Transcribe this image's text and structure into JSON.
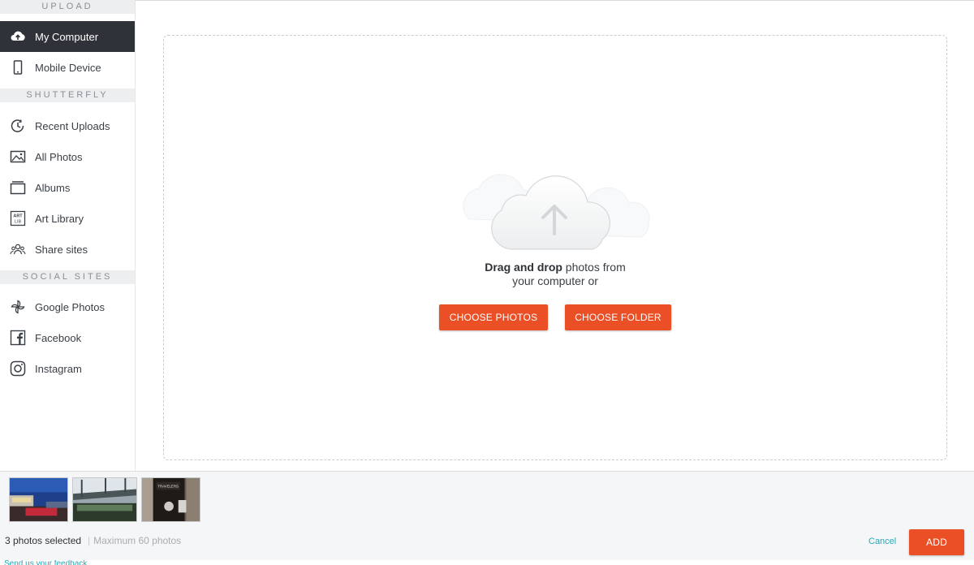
{
  "sidebar": {
    "sections": [
      {
        "header": "UPLOAD"
      },
      {
        "header": "SHUTTERFLY"
      },
      {
        "header": "SOCIAL SITES"
      }
    ],
    "items": [
      {
        "label": "My Computer",
        "icon": "cloud-upload-icon",
        "active": true
      },
      {
        "label": "Mobile Device",
        "icon": "mobile-device-icon"
      },
      {
        "label": "Recent Uploads",
        "icon": "recent-clock-icon"
      },
      {
        "label": "All Photos",
        "icon": "photo-icon"
      },
      {
        "label": "Albums",
        "icon": "album-icon"
      },
      {
        "label": "Art Library",
        "icon": "art-library-icon",
        "icon_text": "ART LIB"
      },
      {
        "label": "Share sites",
        "icon": "share-sites-icon"
      },
      {
        "label": "Google Photos",
        "icon": "google-photos-icon"
      },
      {
        "label": "Facebook",
        "icon": "facebook-icon"
      },
      {
        "label": "Instagram",
        "icon": "instagram-icon"
      }
    ]
  },
  "dropzone": {
    "text_bold": "Drag and drop",
    "text_rest_line1": " photos from",
    "text_line2": "your computer or",
    "choose_photos_label": "CHOOSE PHOTOS",
    "choose_folder_label": "CHOOSE FOLDER"
  },
  "tray": {
    "selected_text": "3 photos selected",
    "separator": "|",
    "maximum_text": "Maximum 60 photos",
    "cancel_label": "Cancel",
    "add_label": "ADD",
    "thumbnails": [
      {
        "name": "thumbnail-1"
      },
      {
        "name": "thumbnail-2"
      },
      {
        "name": "thumbnail-3",
        "sign_text": "TRAVELERS"
      }
    ],
    "feedback_text": "Send us your feedback"
  },
  "colors": {
    "accent_orange": "#ea4f25",
    "active_nav_bg": "#2f3238",
    "link_teal": "#2aa6b5",
    "section_header_bg": "#eceef0"
  }
}
